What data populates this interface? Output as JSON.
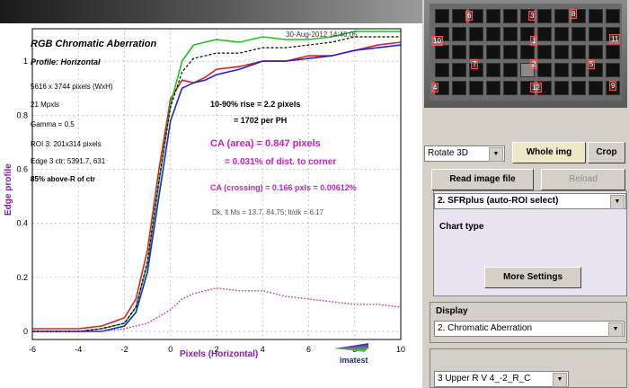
{
  "plot": {
    "title": "RGB Chromatic Aberration",
    "profile": "Profile: Horizontal",
    "timestamp": "30-Aug-2012 14:46:05",
    "info": [
      "5616 x 3744 pixels (WxH)",
      "21 Mpxls",
      "Gamma = 0.5",
      "ROI 3: 201x314 pixels",
      "Edge 3 ctr: 5391.7, 631",
      "85% above-R of ctr"
    ],
    "rise_line1": "10-90% rise = 2.2 pixels",
    "rise_line2": "= 1702 per PH",
    "ca_area_line1": "CA (area) = 0.847 pixels",
    "ca_area_line2": "= 0.031% of dist. to corner",
    "ca_crossing": "CA (crossing) = 0.166 pxls = 0.00612%",
    "dk_lt": "Dk, lt Ms = 13.7, 84.75; lt/dk = 6.17",
    "logo_text": "imatest",
    "colors": {
      "red": "#e02020",
      "green": "#20c020",
      "blue": "#2020e0",
      "black": "#000000",
      "magenta": "#c020c0"
    }
  },
  "chart_data": {
    "type": "line",
    "xlabel": "Pixels (Horizontal)",
    "ylabel": "Edge profile",
    "xlim": [
      -6,
      10
    ],
    "ylim": [
      -0.03,
      1.12
    ],
    "xticks": [
      -6,
      -4,
      -2,
      0,
      2,
      4,
      6,
      8,
      10
    ],
    "yticks": [
      0,
      0.2,
      0.4,
      0.6,
      0.8,
      1
    ],
    "grid": true,
    "series": [
      {
        "color": "#e02020",
        "x": [
          -6,
          -4,
          -3,
          -2,
          -1.5,
          -1,
          -0.5,
          0,
          0.5,
          1,
          1.5,
          2,
          3,
          4,
          5,
          6,
          7,
          8,
          9,
          10
        ],
        "y": [
          0.01,
          0.01,
          0.02,
          0.05,
          0.12,
          0.3,
          0.6,
          0.86,
          0.93,
          0.92,
          0.94,
          0.97,
          0.98,
          1.0,
          1.0,
          1.02,
          1.02,
          1.04,
          1.06,
          1.07
        ]
      },
      {
        "color": "#20c020",
        "x": [
          -6,
          -4,
          -3,
          -2,
          -1.5,
          -1,
          -0.5,
          0,
          0.5,
          1,
          1.5,
          2,
          3,
          4,
          5,
          6,
          7,
          8,
          9,
          10
        ],
        "y": [
          0.0,
          0.0,
          0.01,
          0.03,
          0.09,
          0.25,
          0.55,
          0.84,
          1.0,
          1.06,
          1.07,
          1.08,
          1.07,
          1.09,
          1.08,
          1.08,
          1.09,
          1.11,
          1.11,
          1.11
        ]
      },
      {
        "color": "#2020e0",
        "x": [
          -6,
          -4,
          -3,
          -2,
          -1.5,
          -1,
          -0.5,
          0,
          0.5,
          1,
          1.5,
          2,
          3,
          4,
          5,
          6,
          7,
          8,
          9,
          10
        ],
        "y": [
          0.0,
          0.0,
          0.0,
          0.02,
          0.07,
          0.22,
          0.5,
          0.78,
          0.9,
          0.92,
          0.93,
          0.95,
          0.97,
          1.0,
          1.0,
          1.01,
          1.02,
          1.04,
          1.05,
          1.06
        ]
      },
      {
        "color": "#000000",
        "x": [
          -6,
          -4,
          -3,
          -2,
          -1.5,
          -1,
          -0.5,
          0,
          0.5,
          1,
          1.5,
          2,
          3,
          4,
          5,
          6,
          7,
          8,
          9,
          10
        ],
        "y": [
          0.0,
          0.0,
          0.01,
          0.03,
          0.09,
          0.26,
          0.56,
          0.83,
          0.96,
          1.01,
          1.02,
          1.03,
          1.03,
          1.05,
          1.05,
          1.06,
          1.07,
          1.09,
          1.09,
          1.09
        ]
      },
      {
        "color": "#c020c0",
        "x": [
          -6,
          -4,
          -3,
          -2,
          -1,
          0,
          0.5,
          1,
          2,
          3,
          4,
          5,
          6,
          7,
          8,
          9,
          10
        ],
        "y": [
          0.0,
          0.0,
          0.0,
          0.01,
          0.03,
          0.08,
          0.12,
          0.14,
          0.16,
          0.15,
          0.15,
          0.13,
          0.12,
          0.11,
          0.1,
          0.1,
          0.09
        ]
      }
    ]
  },
  "thumbnail": {
    "roi_labels": [
      "6",
      "3",
      "8",
      "10",
      "1",
      "11",
      "7",
      "2",
      "5",
      "4",
      "12",
      "9"
    ]
  },
  "controls": {
    "rotate": "Rotate 3D",
    "whole_img": "Whole img",
    "crop": "Crop",
    "read_image": "Read image file",
    "reload": "Reload",
    "sfr_select": "2. SFRplus (auto-ROI select)",
    "chart_type": "Chart type",
    "more_settings": "More Settings",
    "display_label": "Display",
    "display_select": "2.  Chromatic Aberration",
    "upper_select": "3  Upper R V    4_-2_R_C"
  }
}
